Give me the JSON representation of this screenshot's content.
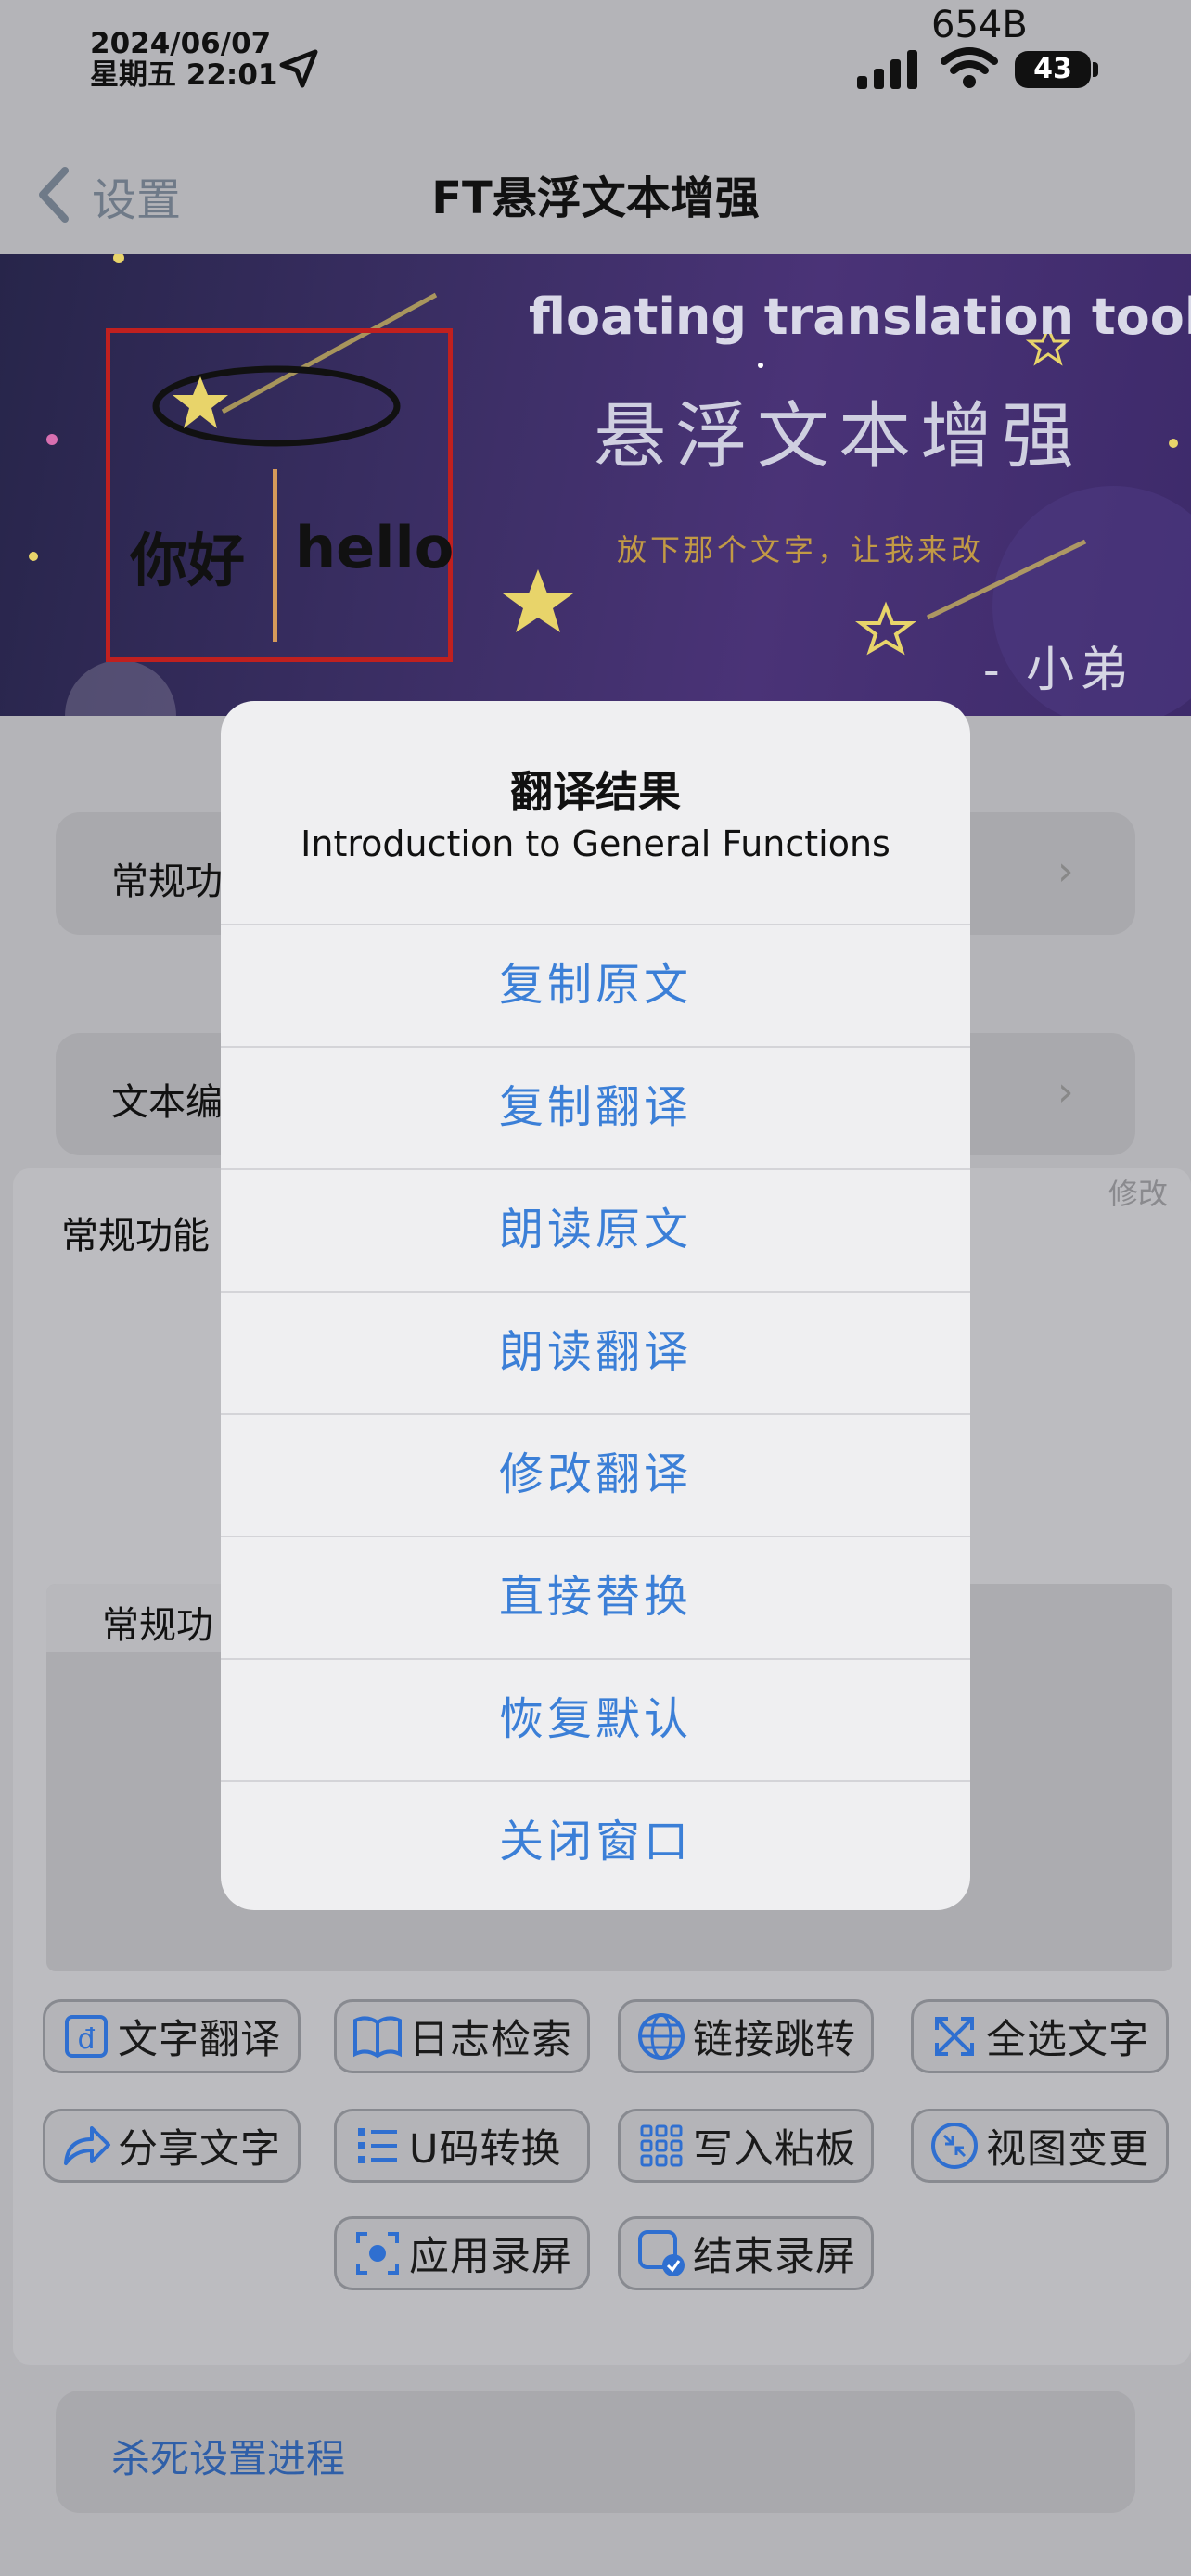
{
  "status_bar": {
    "date": "2024/06/07",
    "weekday_time": "星期五 22:01",
    "network_speed": "654B",
    "battery_level": "43"
  },
  "nav": {
    "back_label": "设置",
    "title": "FT悬浮文本增强"
  },
  "banner": {
    "title_en": "floating translation tool",
    "title_cn": "悬浮文本增强",
    "slogan": "放下那个文字，让我来改",
    "signature": "- 小弟",
    "logo_cn": "你好",
    "logo_en": "hello"
  },
  "list": {
    "item1": "常规功",
    "item2": "文本编"
  },
  "panel": {
    "edit_label": "修改",
    "title": "常规功能",
    "inner_label": "常规功"
  },
  "buttons": [
    {
      "label": "文字翻译",
      "icon": "translate-icon"
    },
    {
      "label": "日志检索",
      "icon": "book-icon"
    },
    {
      "label": "链接跳转",
      "icon": "globe-icon"
    },
    {
      "label": "全选文字",
      "icon": "expand-icon"
    },
    {
      "label": "分享文字",
      "icon": "share-icon"
    },
    {
      "label": "U码转换",
      "icon": "list-icon"
    },
    {
      "label": "写入粘板",
      "icon": "grid-icon"
    },
    {
      "label": "视图变更",
      "icon": "compress-icon"
    },
    {
      "label": "应用录屏",
      "icon": "record-icon"
    },
    {
      "label": "结束录屏",
      "icon": "stop-record-icon"
    }
  ],
  "kill_label": "杀死设置进程",
  "dialog": {
    "title": "翻译结果",
    "message": "Introduction to General Functions",
    "actions": [
      "复制原文",
      "复制翻译",
      "朗读原文",
      "朗读翻译",
      "修改翻译",
      "直接替换",
      "恢复默认",
      "关闭窗口"
    ]
  },
  "colors": {
    "accent": "#3b7fd7",
    "overlay_background": "#b4b4b8",
    "dialog_background": "#efeff1",
    "logo_frame": "#c0201f"
  }
}
